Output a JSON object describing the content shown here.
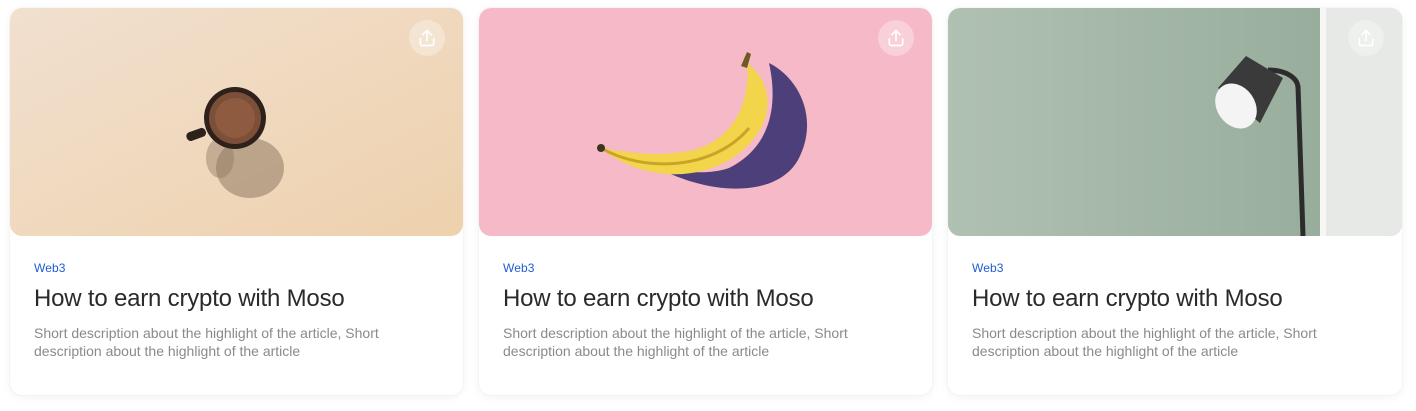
{
  "cards": [
    {
      "tag": "Web3",
      "title": "How to earn crypto with Moso",
      "description": "Short description about the highlight of the article, Short description about the highlight of the article",
      "image": "coffee-cup-photo",
      "bg_color": "#f2dcc2"
    },
    {
      "tag": "Web3",
      "title": "How to earn crypto with Moso",
      "description": "Short description about the highlight of the article, Short description about the highlight of the article",
      "image": "banana-photo",
      "bg_color": "#f6b9c7"
    },
    {
      "tag": "Web3",
      "title": "How to earn crypto with Moso",
      "description": "Short description about the highlight of the article, Short description about the highlight of the article",
      "image": "floor-lamp-photo",
      "bg_color": "#aebfb1"
    }
  ],
  "icons": {
    "share": "share-upload-icon"
  },
  "colors": {
    "tag": "#1f5bd6",
    "title": "#2a2a2a",
    "description": "#8a8a8a"
  }
}
